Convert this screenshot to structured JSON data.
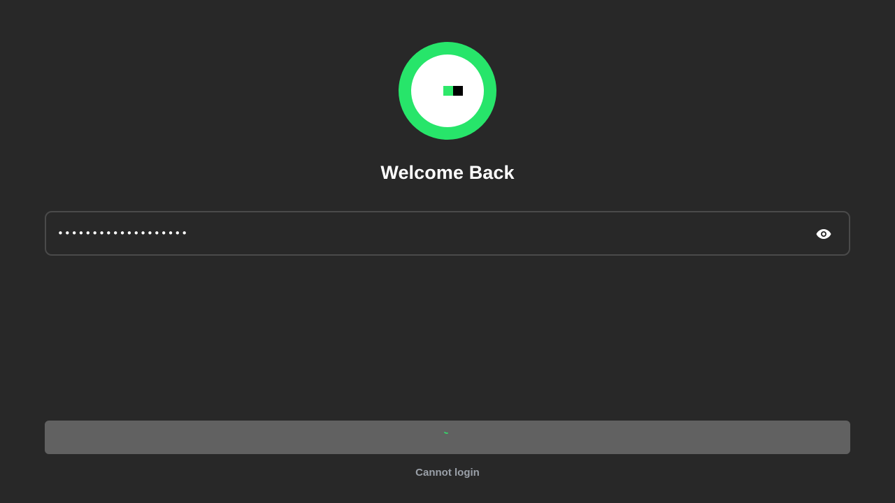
{
  "logo": {
    "icon": "app-logo-icon",
    "ring_color": "#27e56a",
    "mark_green": "#2ee86a",
    "mark_black": "#000000"
  },
  "heading": {
    "title": "Welcome Back"
  },
  "password": {
    "value": "•••••••••••••••••••",
    "toggle_icon": "eye-icon"
  },
  "submit": {
    "state": "loading",
    "spinner_icon": "spinner-icon",
    "accent": "#2ee86a"
  },
  "footer": {
    "cannot_login_label": "Cannot login"
  }
}
